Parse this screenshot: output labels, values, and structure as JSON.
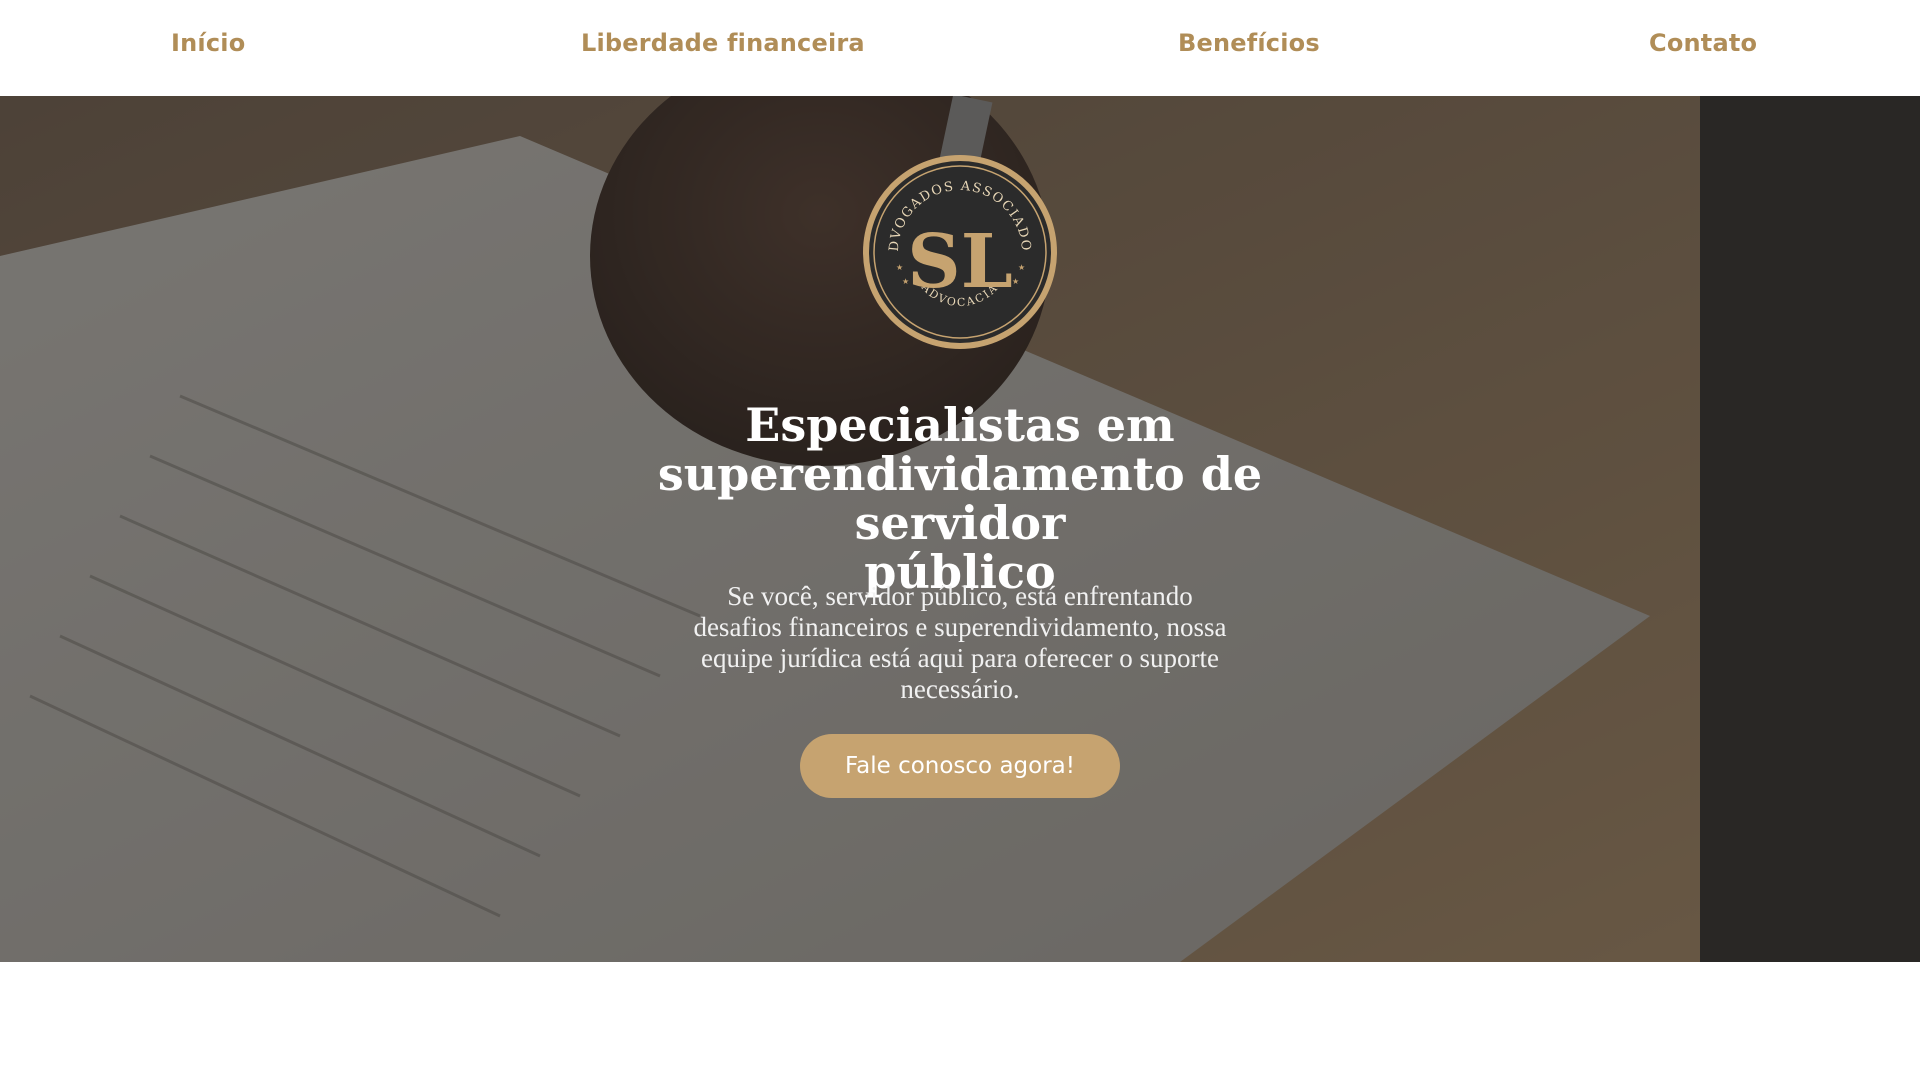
{
  "nav": {
    "items": [
      {
        "label": "Início"
      },
      {
        "label": "Liberdade financeira"
      },
      {
        "label": "Benefícios"
      },
      {
        "label": "Contato"
      }
    ]
  },
  "hero": {
    "background": "photo-hand-signing-document",
    "logo": {
      "icon": "sl-monogram-seal-icon",
      "top_text": "ADVOGADOS ASSOCIADOS",
      "bottom_text": "ADVOCACIA",
      "monogram": "SL"
    },
    "title_lines": [
      "Especialistas em",
      "superendividamento de servidor",
      "público"
    ],
    "subtitle_lines": [
      "Se você, servidor público, está enfrentando",
      "desafios financeiros e superendividamento, nossa",
      "equipe jurídica está aqui para oferecer o suporte",
      "necessário."
    ],
    "cta_label": "Fale conosco agora!"
  },
  "colors": {
    "accent_gold": "#b08d57",
    "button_gold": "#c6a370",
    "seal_dark": "#2b2b2b",
    "hero_overlay": "#3a3836"
  }
}
